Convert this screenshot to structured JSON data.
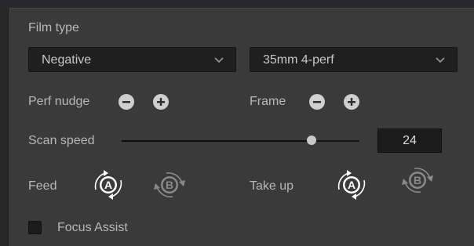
{
  "film_type": {
    "label": "Film type",
    "selected": "Negative",
    "format_selected": "35mm 4-perf"
  },
  "perf_nudge": {
    "label": "Perf nudge",
    "minus_icon": "minus-circle-icon",
    "plus_icon": "plus-circle-icon"
  },
  "frame": {
    "label": "Frame",
    "minus_icon": "minus-circle-icon",
    "plus_icon": "plus-circle-icon"
  },
  "scan_speed": {
    "label": "Scan speed",
    "value": "24",
    "slider_fraction": 0.8
  },
  "feed": {
    "label": "Feed",
    "a_label": "A",
    "b_label": "B",
    "active": "A"
  },
  "take_up": {
    "label": "Take up",
    "a_label": "A",
    "b_label": "B",
    "active": "A"
  },
  "focus_assist": {
    "label": "Focus Assist",
    "checked": false
  },
  "colors": {
    "background": "#28282a",
    "panel": "#3a3a3b",
    "field": "#1f1f20",
    "text": "#b8b8b8",
    "active_spool": "#ffffff",
    "inactive_spool": "#8a8a8a"
  }
}
